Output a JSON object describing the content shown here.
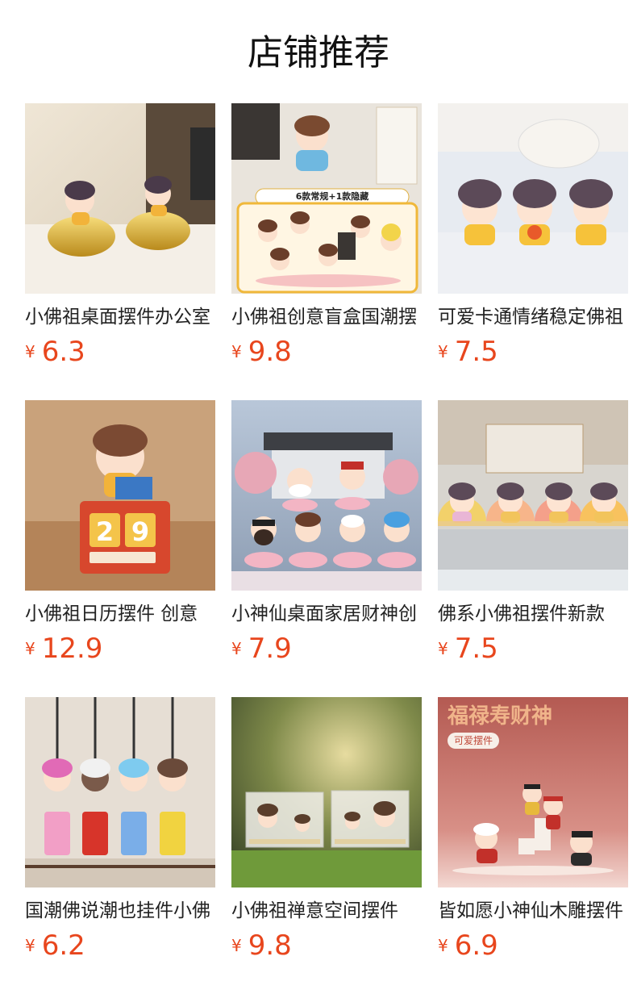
{
  "page": {
    "title": "店铺推荐"
  },
  "products": [
    {
      "name": "小佛祖桌面摆件办公室",
      "currency": "¥",
      "price": "6.3",
      "image": "figurines-on-gold-ingots",
      "image_text": ""
    },
    {
      "name": "小佛祖创意盲盒国潮摆",
      "currency": "¥",
      "price": "9.8",
      "image": "blind-box-figurines-display",
      "image_text": "6款常规+1款隐藏"
    },
    {
      "name": "可爱卡通情绪稳定佛祖",
      "currency": "¥",
      "price": "7.5",
      "image": "three-buddha-figurines",
      "image_text": ""
    },
    {
      "name": "小佛祖日历摆件 创意",
      "currency": "¥",
      "price": "12.9",
      "image": "figurine-calendar",
      "image_text": ""
    },
    {
      "name": "小神仙桌面家居财神创",
      "currency": "¥",
      "price": "7.9",
      "image": "deity-figurines-on-lotus",
      "image_text": ""
    },
    {
      "name": "佛系小佛祖摆件新款",
      "currency": "¥",
      "price": "7.5",
      "image": "figurines-with-halos",
      "image_text": ""
    },
    {
      "name": "国潮佛说潮也挂件小佛",
      "currency": "¥",
      "price": "6.2",
      "image": "hanging-charm-pendants",
      "image_text": ""
    },
    {
      "name": "小佛祖禅意空间摆件",
      "currency": "¥",
      "price": "9.8",
      "image": "zen-space-acrylic-boxes",
      "image_text": ""
    },
    {
      "name": "皆如愿小神仙木雕摆件",
      "currency": "¥",
      "price": "6.9",
      "image": "fu-lu-shou-cai-shen-figurines",
      "image_text": "福禄寿财神"
    }
  ],
  "extra": {
    "badge9": "可爱摆件"
  },
  "colors": {
    "price": "#e8461d",
    "title": "#111111"
  }
}
